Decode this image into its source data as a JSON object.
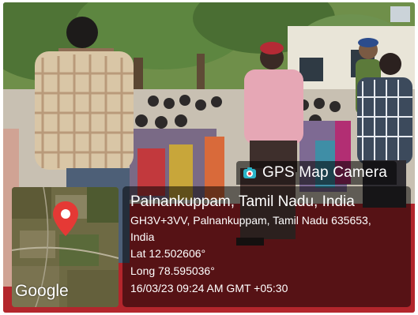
{
  "camera_app": {
    "title": "GPS Map Camera",
    "icon": "camera-pin-icon"
  },
  "location": {
    "place": "Palnankuppam, Tamil Nadu, India",
    "address_line1": "GH3V+3VV, Palnankuppam, Tamil Nadu 635653,",
    "address_line2": "India",
    "latitude": "Lat 12.502606°",
    "longitude": "Long 78.595036°",
    "datetime": "16/03/23 09:24 AM GMT +05:30"
  },
  "map": {
    "brand": "Google",
    "pin_icon": "map-pin-icon",
    "pin_color": "#e53935"
  },
  "colors": {
    "overlay": "#000000",
    "ground_red": "#b3262c",
    "sky": "#dfe6ec"
  }
}
